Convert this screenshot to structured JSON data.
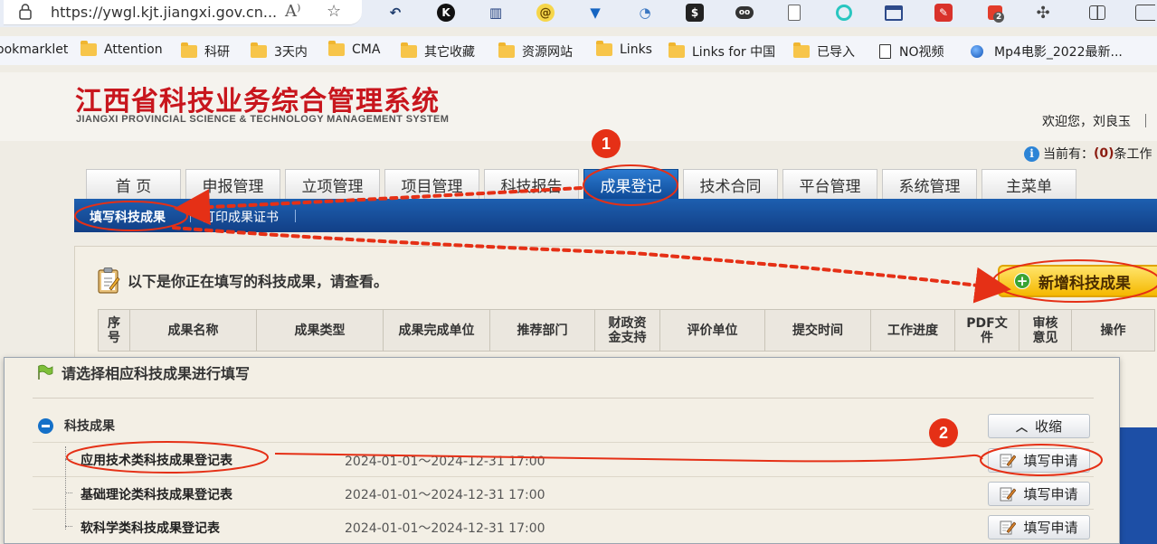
{
  "browser": {
    "url": "https://ywgl.kjt.jiangxi.gov.cn...",
    "extension_badge": "2",
    "bookmarks": [
      {
        "label": "ookmarklet",
        "icon": "none"
      },
      {
        "label": "Attention",
        "icon": "folder-icon"
      },
      {
        "label": "科研",
        "icon": "folder-icon"
      },
      {
        "label": "3天内",
        "icon": "folder-icon"
      },
      {
        "label": "CMA",
        "icon": "folder-icon"
      },
      {
        "label": "其它收藏",
        "icon": "folder-icon"
      },
      {
        "label": "资源网站",
        "icon": "folder-icon"
      },
      {
        "label": "Links",
        "icon": "folder-icon"
      },
      {
        "label": "Links for 中国",
        "icon": "folder-icon"
      },
      {
        "label": "已导入",
        "icon": "folder-icon"
      },
      {
        "label": "NO视频",
        "icon": "page-icon"
      },
      {
        "label": "Mp4电影_2022最新...",
        "icon": "globe-icon"
      }
    ]
  },
  "site": {
    "title": "江西省科技业务综合管理系统",
    "subtitle": "JIANGXI PROVINCIAL SCIENCE & TECHNOLOGY MANAGEMENT SYSTEM",
    "welcome": "欢迎您，刘良玉",
    "notice_prefix": "当前有：",
    "notice_count": "(0)",
    "notice_suffix": "条工作"
  },
  "nav": {
    "tabs": [
      "首 页",
      "申报管理",
      "立项管理",
      "项目管理",
      "科技报告",
      "成果登记",
      "技术合同",
      "平台管理",
      "系统管理",
      "主菜单"
    ],
    "active_tab": "成果登记",
    "subtabs": [
      "填写科技成果",
      "打印成果证书"
    ]
  },
  "content": {
    "intro": "以下是你正在填写的科技成果，请查看。",
    "add_button": "新增科技成果",
    "table_headers": [
      "序号",
      "成果名称",
      "成果类型",
      "成果完成单位",
      "推荐部门",
      "财政资金支持",
      "评价单位",
      "提交时间",
      "工作进度",
      "PDF文件",
      "审核意见",
      "操作"
    ]
  },
  "dialog": {
    "title": "请选择相应科技成果进行填写",
    "group": "科技成果",
    "collapse_button": "收缩",
    "rows": [
      {
        "name": "应用技术类科技成果登记表",
        "period": "2024-01-01～2024-12-31 17:00",
        "button": "填写申请"
      },
      {
        "name": "基础理论类科技成果登记表",
        "period": "2024-01-01～2024-12-31 17:00",
        "button": "填写申请"
      },
      {
        "name": "软科学类科技成果登记表",
        "period": "2024-01-01～2024-12-31 17:00",
        "button": "填写申请"
      }
    ]
  },
  "annotations": {
    "step1": "1",
    "step2": "2",
    "color": "#e53016"
  }
}
